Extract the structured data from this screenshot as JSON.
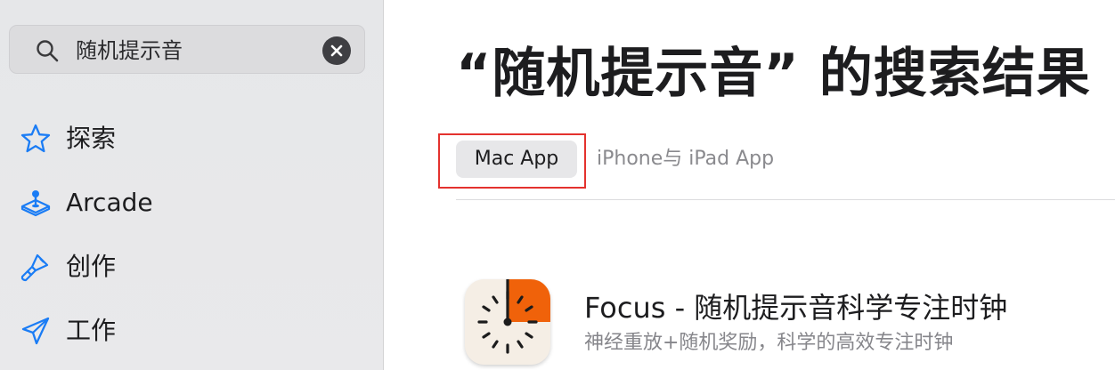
{
  "sidebar": {
    "search": {
      "value": "随机提示音",
      "icon": "search-icon",
      "clear_icon": "clear-icon"
    },
    "items": [
      {
        "label": "探索",
        "icon": "star-icon"
      },
      {
        "label": "Arcade",
        "icon": "joystick-icon"
      },
      {
        "label": "创作",
        "icon": "brush-icon"
      },
      {
        "label": "工作",
        "icon": "paper-plane-icon"
      }
    ]
  },
  "main": {
    "title": "“随机提示音” 的搜索结果",
    "tabs": [
      {
        "label": "Mac App",
        "selected": true
      },
      {
        "label": "iPhone与 iPad App",
        "selected": false
      }
    ],
    "results": [
      {
        "title": "Focus - 随机提示音科学专注时钟",
        "subtitle": "神经重放+随机奖励，科学的高效专注时钟",
        "icon": "focus-timer-app-icon"
      }
    ]
  },
  "colors": {
    "accent": "#1a7cf5",
    "highlight": "#e4322e",
    "sidebar_bg": "#e7e8ea",
    "app_icon_orange": "#f0620a"
  }
}
